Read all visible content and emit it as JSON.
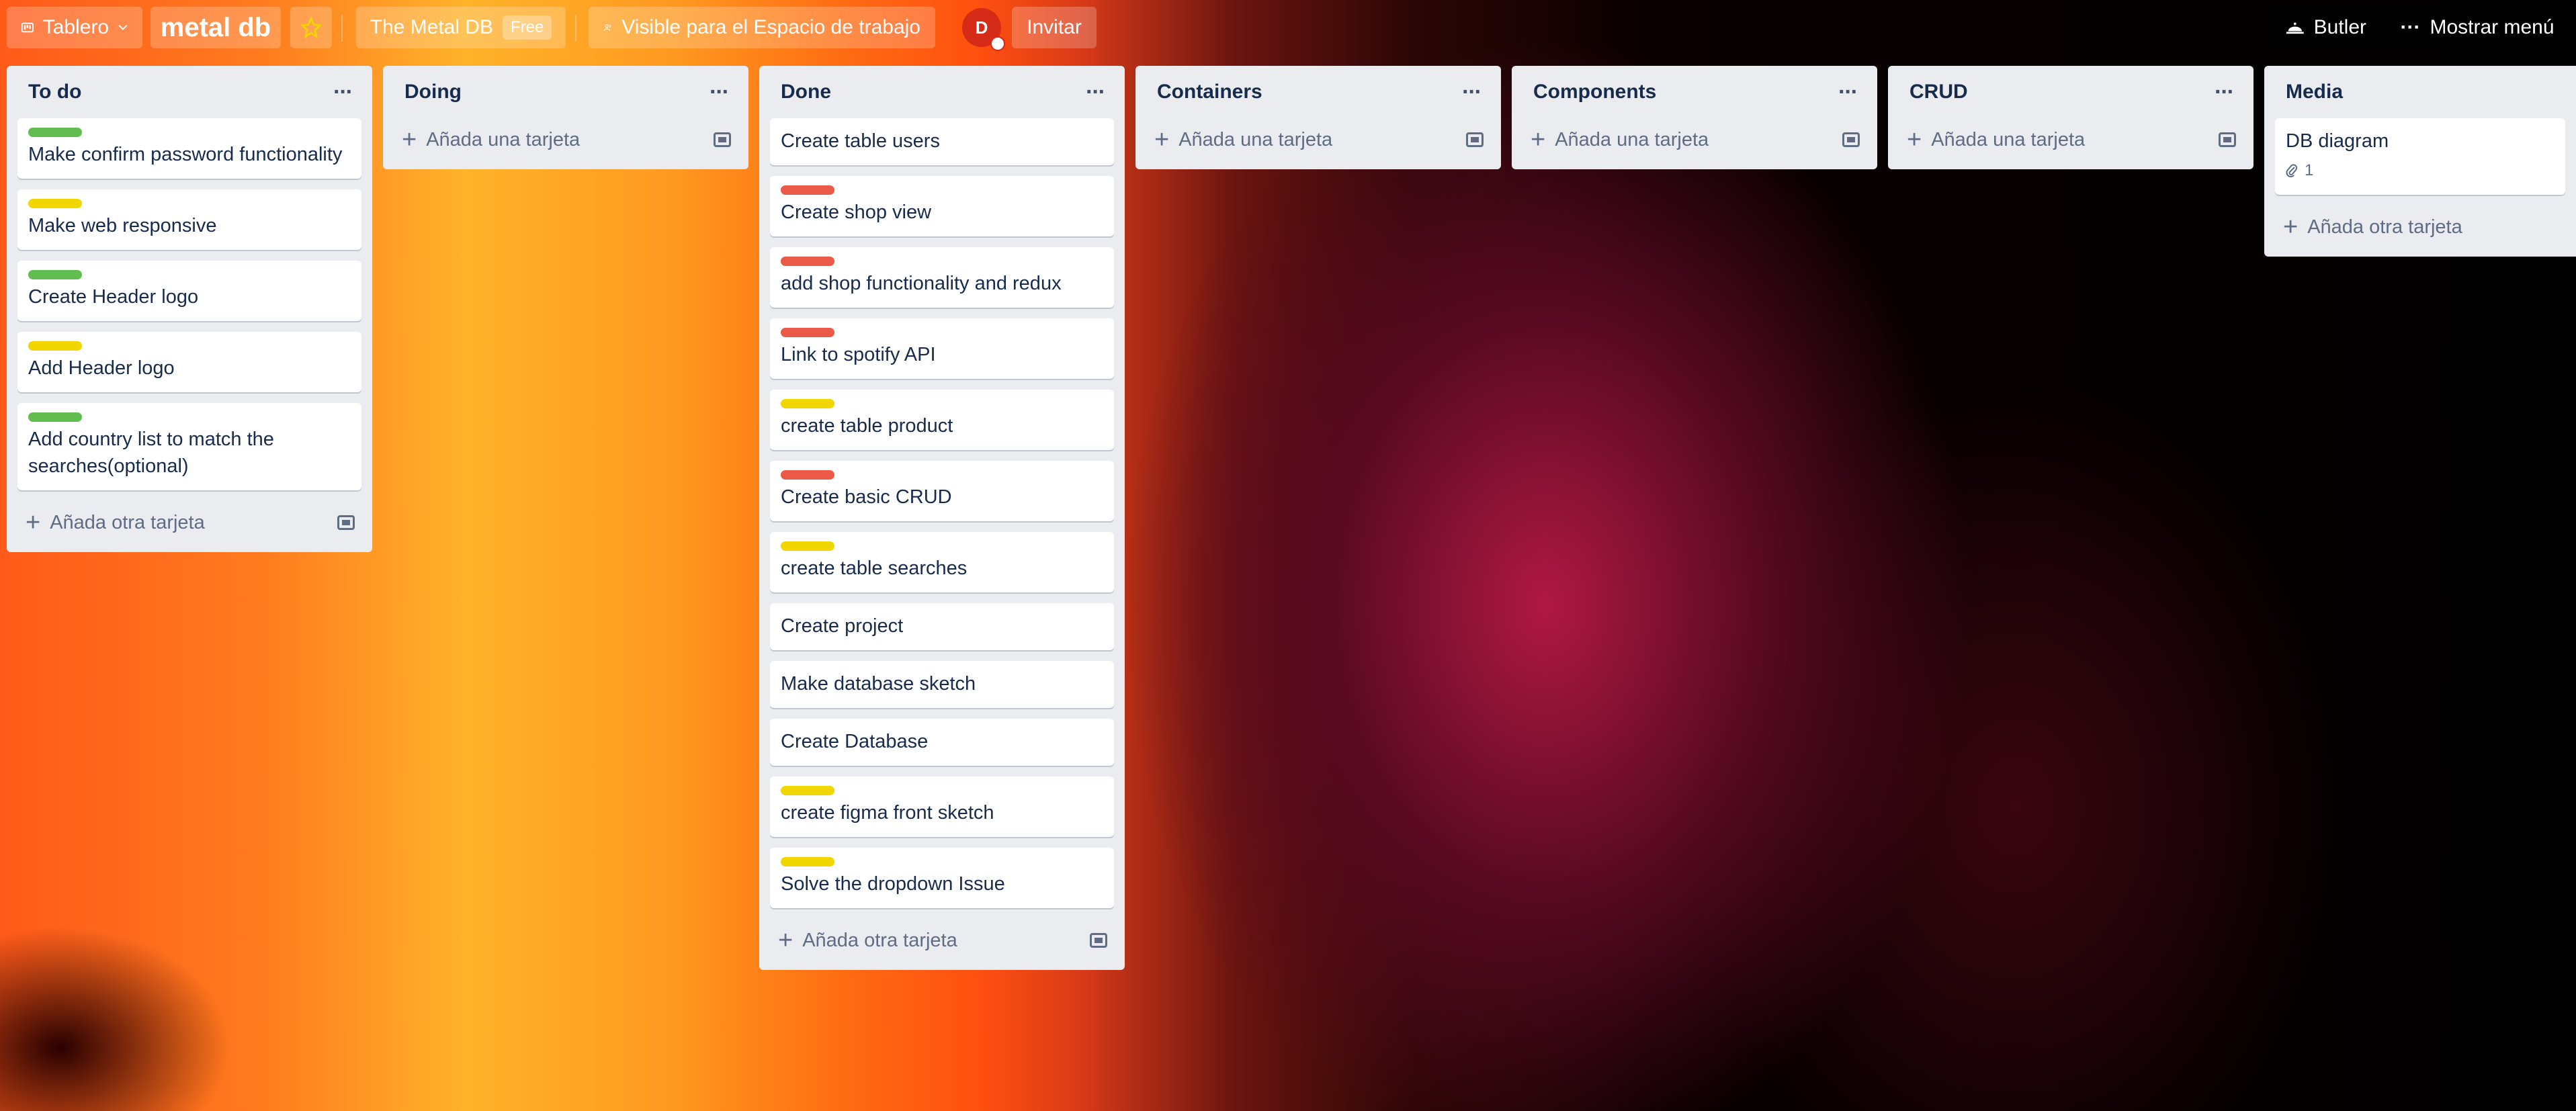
{
  "header": {
    "board_menu_label": "Tablero",
    "board_title": "metal db",
    "workspace_name": "The Metal DB",
    "workspace_badge": "Free",
    "visibility_label": "Visible para el Espacio de trabajo",
    "avatar_initial": "D",
    "invite_label": "Invitar",
    "butler_label": "Butler",
    "menu_label": "Mostrar menú"
  },
  "colors": {
    "green": "#61bd4f",
    "yellow": "#f2d600",
    "red": "#eb5a46"
  },
  "lists": [
    {
      "title": "To do",
      "add_label": "Añada otra tarjeta",
      "cards": [
        {
          "text": "Make confirm password functionality",
          "label": "green"
        },
        {
          "text": "Make web responsive",
          "label": "yellow"
        },
        {
          "text": "Create Header logo",
          "label": "green"
        },
        {
          "text": "Add Header logo",
          "label": "yellow"
        },
        {
          "text": "Add country list to match the searches(optional)",
          "label": "green"
        }
      ]
    },
    {
      "title": "Doing",
      "add_label": "Añada una tarjeta",
      "cards": []
    },
    {
      "title": "Done",
      "add_label": "Añada otra tarjeta",
      "cards": [
        {
          "text": "Create table users",
          "label": ""
        },
        {
          "text": "Create shop view",
          "label": "red"
        },
        {
          "text": "add shop functionality and redux",
          "label": "red"
        },
        {
          "text": "Link to spotify API",
          "label": "red"
        },
        {
          "text": "create table product",
          "label": "yellow"
        },
        {
          "text": "Create basic CRUD",
          "label": "red"
        },
        {
          "text": "create table searches",
          "label": "yellow"
        },
        {
          "text": "Create project",
          "label": ""
        },
        {
          "text": "Make database sketch",
          "label": ""
        },
        {
          "text": "Create Database",
          "label": ""
        },
        {
          "text": "create figma front sketch",
          "label": "yellow"
        },
        {
          "text": "Solve the dropdown Issue",
          "label": "yellow"
        }
      ]
    },
    {
      "title": "Containers",
      "add_label": "Añada una tarjeta",
      "cards": []
    },
    {
      "title": "Components",
      "add_label": "Añada una tarjeta",
      "cards": []
    },
    {
      "title": "CRUD",
      "add_label": "Añada una tarjeta",
      "cards": []
    },
    {
      "title": "Media",
      "add_label": "Añada otra tarjeta",
      "cards": [
        {
          "text": "DB diagram",
          "label": "",
          "attachments": "1"
        }
      ]
    }
  ]
}
